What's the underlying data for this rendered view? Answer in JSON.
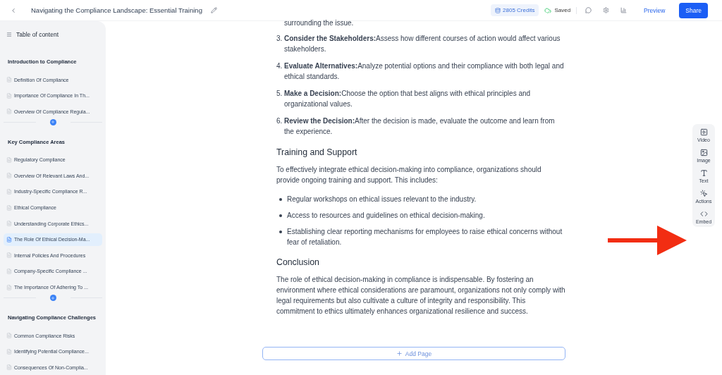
{
  "header": {
    "title": "Navigating the Compliance Landscape: Essential Training",
    "credits": "2805 Credits",
    "save_status": "Saved",
    "preview": "Preview",
    "share": "Share"
  },
  "sidebar": {
    "title": "Table of content",
    "sections": [
      {
        "title": "Introduction to Compliance",
        "items": [
          {
            "label": "Definition Of Compliance",
            "selected": false
          },
          {
            "label": "Importance Of Compliance In Th...",
            "selected": false
          },
          {
            "label": "Overview Of Compliance Regula...",
            "selected": false
          }
        ]
      },
      {
        "title": "Key Compliance Areas",
        "items": [
          {
            "label": "Regulatory Compliance",
            "selected": false
          },
          {
            "label": "Overview Of Relevant Laws And...",
            "selected": false
          },
          {
            "label": "Industry-Specific Compliance R...",
            "selected": false
          },
          {
            "label": "Ethical Compliance",
            "selected": false
          },
          {
            "label": "Understanding Corporate Ethics...",
            "selected": false
          },
          {
            "label": "The Role Of Ethical Decision-Ma...",
            "selected": true
          },
          {
            "label": "Internal Policies And Procedures",
            "selected": false
          },
          {
            "label": "Company-Specific Compliance ...",
            "selected": false
          },
          {
            "label": "The Importance Of Adhering To ...",
            "selected": false
          }
        ]
      },
      {
        "title": "Navigating Compliance Challenges",
        "items": [
          {
            "label": "Common Compliance Risks",
            "selected": false
          },
          {
            "label": "Identifying Potential Compliance...",
            "selected": false
          },
          {
            "label": "Consequences Of Non-Complia...",
            "selected": false
          }
        ]
      }
    ]
  },
  "content": {
    "cut_line": "surrounding the issue.",
    "steps": [
      {
        "number": "3.",
        "text": "**Consider the Stakeholders:**Assess how different courses of action would affect various stakeholders."
      },
      {
        "number": "4.",
        "text": "**Evaluate Alternatives:**Analyze potential options and their compliance with both legal and ethical standards."
      },
      {
        "number": "5.",
        "text": "**Make a Decision:**Choose the option that best aligns with ethical principles and organizational values."
      },
      {
        "number": "6.",
        "text": "**Review the Decision:**After the decision is made, evaluate the outcome and learn from the experience."
      }
    ],
    "training_heading": "Training and Support",
    "training_text": "To effectively integrate ethical decision-making into compliance, organizations should provide ongoing training and support. This includes:",
    "bullets": [
      "Regular workshops on ethical issues relevant to the industry.",
      "Access to resources and guidelines on ethical decision-making.",
      "Establishing clear reporting mechanisms for employees to raise ethical concerns without fear of retaliation."
    ],
    "conclusion_heading": "Conclusion",
    "conclusion_text": "The role of ethical decision-making in compliance is indispensable. By fostering an environment where ethical considerations are paramount, organizations not only comply with legal requirements but also cultivate a culture of integrity and responsibility. This commitment to ethics ultimately enhances organizational resilience and success.",
    "add_page": "Add Page"
  },
  "toolbar": [
    {
      "kind": "video",
      "label": "Video"
    },
    {
      "kind": "image",
      "label": "Image"
    },
    {
      "kind": "text",
      "label": "Text"
    },
    {
      "kind": "actions",
      "label": "Actions"
    },
    {
      "kind": "embed",
      "label": "Embed"
    }
  ]
}
